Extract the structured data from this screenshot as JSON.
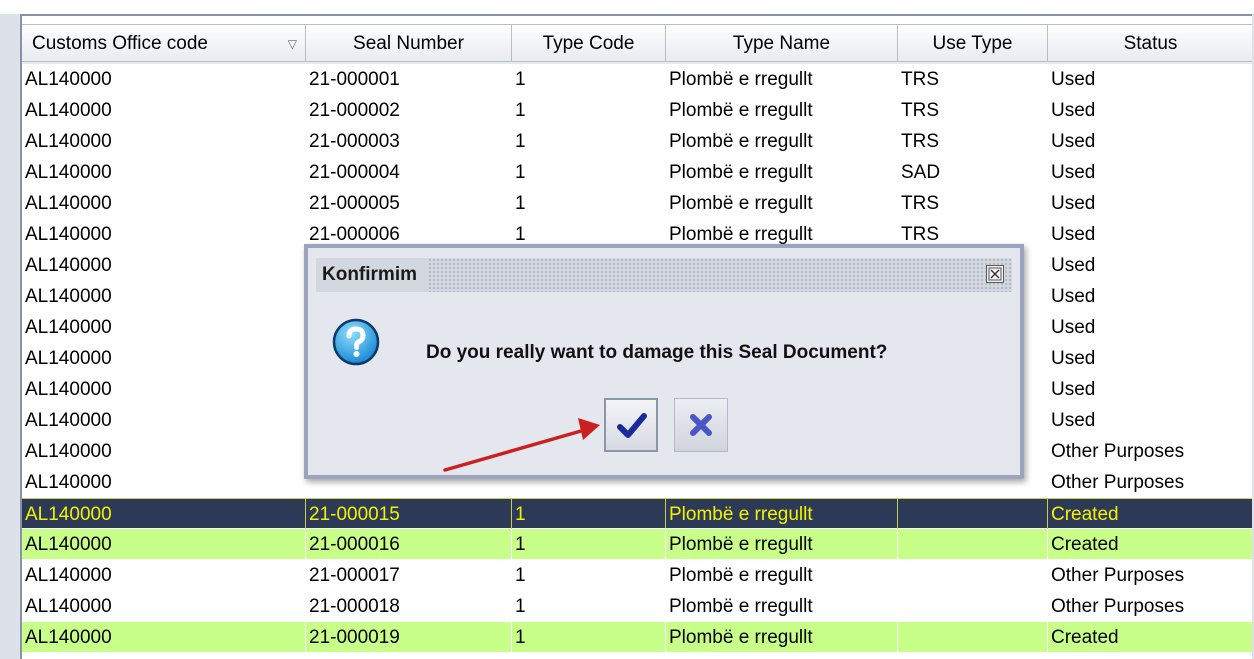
{
  "table": {
    "columns": [
      "Customs Office code",
      "Seal Number",
      "Type Code",
      "Type Name",
      "Use Type",
      "Status"
    ],
    "sort_indicator": "▽",
    "rows": [
      {
        "office": "AL140000",
        "seal": "21-000001",
        "type_code": "1",
        "type_name": "Plombë e rregullt",
        "use_type": "TRS",
        "status": "Used",
        "state": "normal"
      },
      {
        "office": "AL140000",
        "seal": "21-000002",
        "type_code": "1",
        "type_name": "Plombë e rregullt",
        "use_type": "TRS",
        "status": "Used",
        "state": "normal"
      },
      {
        "office": "AL140000",
        "seal": "21-000003",
        "type_code": "1",
        "type_name": "Plombë e rregullt",
        "use_type": "TRS",
        "status": "Used",
        "state": "normal"
      },
      {
        "office": "AL140000",
        "seal": "21-000004",
        "type_code": "1",
        "type_name": "Plombë e rregullt",
        "use_type": "SAD",
        "status": "Used",
        "state": "normal"
      },
      {
        "office": "AL140000",
        "seal": "21-000005",
        "type_code": "1",
        "type_name": "Plombë e rregullt",
        "use_type": "TRS",
        "status": "Used",
        "state": "normal"
      },
      {
        "office": "AL140000",
        "seal": "21-000006",
        "type_code": "1",
        "type_name": "Plombë e rregullt",
        "use_type": "TRS",
        "status": "Used",
        "state": "normal"
      },
      {
        "office": "AL140000",
        "seal": "",
        "type_code": "",
        "type_name": "",
        "use_type": "",
        "status": "Used",
        "state": "normal"
      },
      {
        "office": "AL140000",
        "seal": "",
        "type_code": "",
        "type_name": "",
        "use_type": "",
        "status": "Used",
        "state": "normal"
      },
      {
        "office": "AL140000",
        "seal": "",
        "type_code": "",
        "type_name": "",
        "use_type": "",
        "status": "Used",
        "state": "normal"
      },
      {
        "office": "AL140000",
        "seal": "",
        "type_code": "",
        "type_name": "",
        "use_type": "",
        "status": "Used",
        "state": "normal"
      },
      {
        "office": "AL140000",
        "seal": "",
        "type_code": "",
        "type_name": "",
        "use_type": "",
        "status": "Used",
        "state": "normal"
      },
      {
        "office": "AL140000",
        "seal": "",
        "type_code": "",
        "type_name": "",
        "use_type": "",
        "status": "Used",
        "state": "normal"
      },
      {
        "office": "AL140000",
        "seal": "",
        "type_code": "",
        "type_name": "",
        "use_type": "",
        "status": "Other Purposes",
        "state": "normal"
      },
      {
        "office": "AL140000",
        "seal": "",
        "type_code": "",
        "type_name": "",
        "use_type": "",
        "status": "Other Purposes",
        "state": "normal"
      },
      {
        "office": "AL140000",
        "seal": "21-000015",
        "type_code": "1",
        "type_name": "Plombë e rregullt",
        "use_type": "",
        "status": "Created",
        "state": "selected"
      },
      {
        "office": "AL140000",
        "seal": "21-000016",
        "type_code": "1",
        "type_name": "Plombë e rregullt",
        "use_type": "",
        "status": "Created",
        "state": "created"
      },
      {
        "office": "AL140000",
        "seal": "21-000017",
        "type_code": "1",
        "type_name": "Plombë e rregullt",
        "use_type": "",
        "status": "Other Purposes",
        "state": "normal"
      },
      {
        "office": "AL140000",
        "seal": "21-000018",
        "type_code": "1",
        "type_name": "Plombë e rregullt",
        "use_type": "",
        "status": "Other Purposes",
        "state": "normal"
      },
      {
        "office": "AL140000",
        "seal": "21-000019",
        "type_code": "1",
        "type_name": "Plombë e rregullt",
        "use_type": "",
        "status": "Created",
        "state": "created"
      }
    ]
  },
  "dialog": {
    "title": "Konfirmim",
    "message": "Do you really want to damage this Seal Document?",
    "icon": "question-icon",
    "confirm_icon": "checkmark-icon",
    "cancel_icon": "x-icon",
    "close_icon": "close-icon"
  },
  "colors": {
    "created_row": "#c8ff88",
    "selected_row": "#2c3a58",
    "selected_text": "#f2f200",
    "arrow": "#cc1f1f",
    "check": "#1a2a9a",
    "cancel_x": "#4a55c8"
  }
}
